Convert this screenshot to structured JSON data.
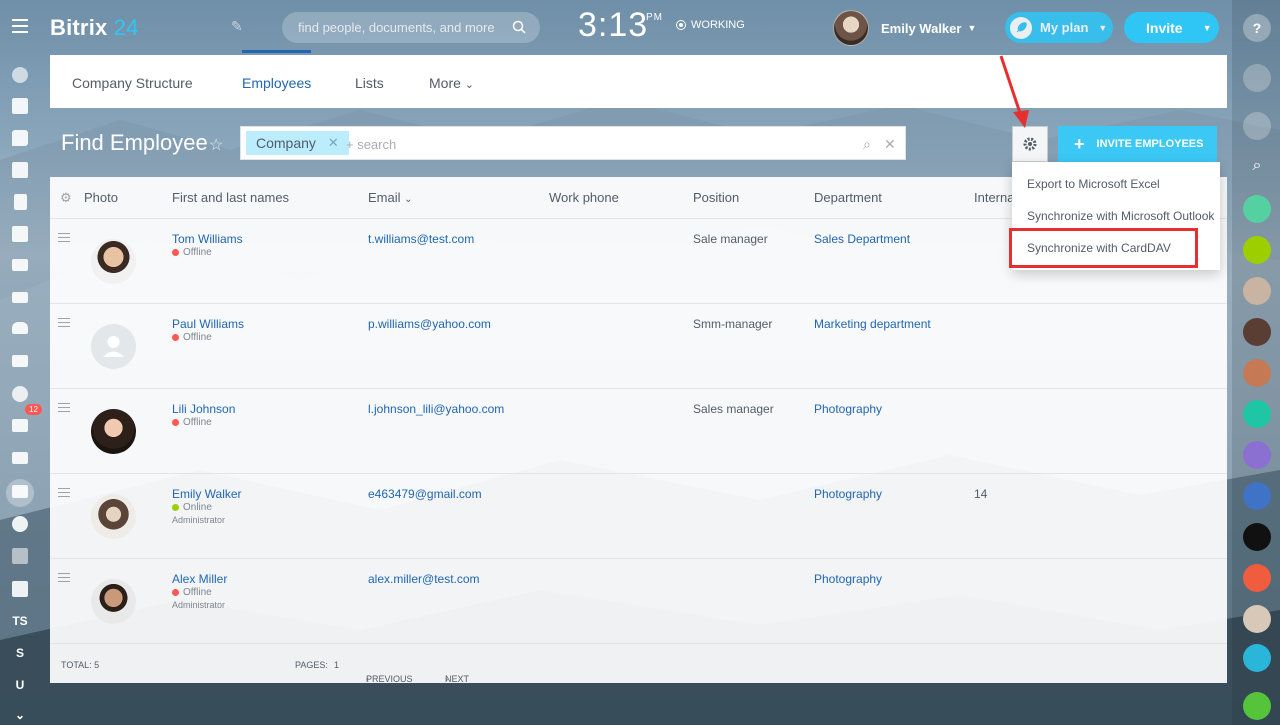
{
  "topbar": {
    "logo_main": "Bitrix",
    "logo_num": "24",
    "search_placeholder": "find people, documents, and more",
    "time": "3:13",
    "ampm": "PM",
    "working": "WORKING",
    "user_name": "Emily Walker",
    "myplan": "My plan",
    "invite": "Invite"
  },
  "tabs": [
    {
      "label": "Company Structure"
    },
    {
      "label": "Employees"
    },
    {
      "label": "Lists"
    },
    {
      "label": "More"
    }
  ],
  "page": {
    "title": "Find Employee",
    "filter_chip": "Company",
    "filter_placeholder": "+ search",
    "invite_employees": "INVITE EMPLOYEES"
  },
  "columns": {
    "photo": "Photo",
    "name": "First and last names",
    "email": "Email",
    "work_phone": "Work phone",
    "position": "Position",
    "department": "Department",
    "internal": "Interna"
  },
  "rows": [
    {
      "name": "Tom Williams",
      "status": "Offline",
      "role": "",
      "email": "t.williams@test.com",
      "position": "Sale manager",
      "department": "Sales Department",
      "internal": ""
    },
    {
      "name": "Paul Williams",
      "status": "Offline",
      "role": "",
      "email": "p.williams@yahoo.com",
      "position": "Smm-manager",
      "department": "Marketing department",
      "internal": ""
    },
    {
      "name": "Lili Johnson",
      "status": "Offline",
      "role": "",
      "email": "l.johnson_lili@yahoo.com",
      "position": "Sales manager",
      "department": "Photography",
      "internal": ""
    },
    {
      "name": "Emily Walker",
      "status": "Online",
      "role": "Administrator",
      "email": "e463479@gmail.com",
      "position": "",
      "department": "Photography",
      "internal": "14"
    },
    {
      "name": "Alex Miller",
      "status": "Offline",
      "role": "Administrator",
      "email": "alex.miller@test.com",
      "position": "",
      "department": "Photography",
      "internal": ""
    }
  ],
  "footer": {
    "total": "TOTAL: 5",
    "pages_label": "PAGES:",
    "pages_value": "1",
    "previous": "PREVIOUS",
    "next": "NEXT"
  },
  "menu": {
    "items": [
      {
        "label": "Export to Microsoft Excel"
      },
      {
        "label": "Synchronize with Microsoft Outlook"
      },
      {
        "label": "Synchronize with CardDAV"
      }
    ]
  },
  "sidebar": {
    "badge": "12",
    "text_items": [
      "TS",
      "S",
      "U"
    ]
  },
  "colors": {
    "accent": "#2fc6f6",
    "link": "#2066b0",
    "offline": "#ff5752",
    "online": "#9dcf00",
    "highlight": "#e6302f"
  }
}
